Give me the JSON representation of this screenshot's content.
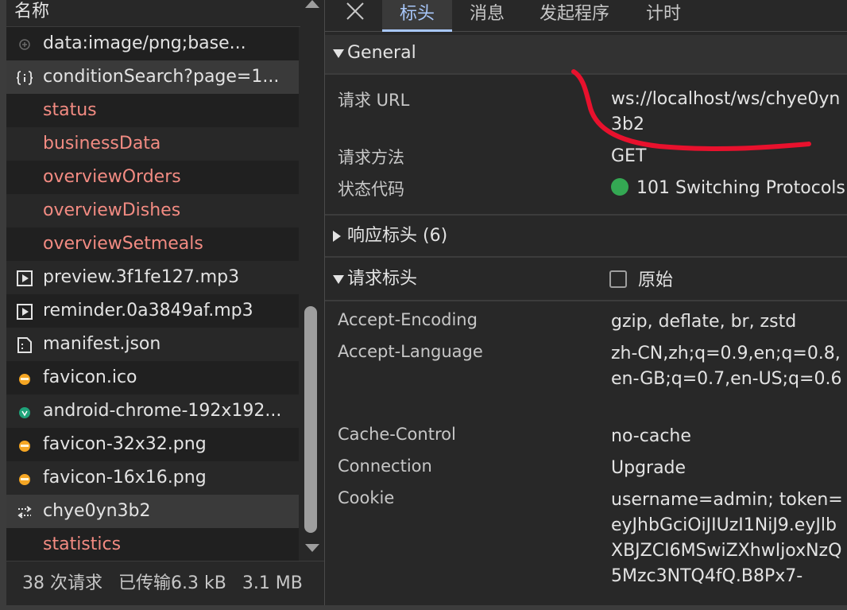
{
  "request_list": {
    "header": "名称",
    "rows": [
      {
        "icon": "image-icon",
        "name": "data:image/png;base...",
        "style": "normal"
      },
      {
        "icon": "fetch-icon",
        "name": "conditionSearch?page=1...",
        "style": "normal"
      },
      {
        "icon": "",
        "name": "status",
        "style": "red"
      },
      {
        "icon": "",
        "name": "businessData",
        "style": "red"
      },
      {
        "icon": "",
        "name": "overviewOrders",
        "style": "red"
      },
      {
        "icon": "",
        "name": "overviewDishes",
        "style": "red"
      },
      {
        "icon": "",
        "name": "overviewSetmeals",
        "style": "red"
      },
      {
        "icon": "media-icon",
        "name": "preview.3f1fe127.mp3",
        "style": "normal"
      },
      {
        "icon": "media-icon",
        "name": "reminder.0a3849af.mp3",
        "style": "normal"
      },
      {
        "icon": "document-icon",
        "name": "manifest.json",
        "style": "normal"
      },
      {
        "icon": "favicon-orange-icon",
        "name": "favicon.ico",
        "style": "normal"
      },
      {
        "icon": "favicon-green-icon",
        "name": "android-chrome-192x192...",
        "style": "normal"
      },
      {
        "icon": "favicon-orange-icon",
        "name": "favicon-32x32.png",
        "style": "normal"
      },
      {
        "icon": "favicon-orange-icon",
        "name": "favicon-16x16.png",
        "style": "normal"
      },
      {
        "icon": "websocket-icon",
        "name": "chye0yn3b2",
        "style": "selected"
      },
      {
        "icon": "",
        "name": "statistics",
        "style": "red"
      }
    ],
    "footer": {
      "requests": "38 次请求",
      "transferred": "已传输6.3 kB",
      "resources": "3.1 MB"
    }
  },
  "detail": {
    "tabs": [
      "标头",
      "消息",
      "发起程序",
      "计时"
    ],
    "active_tab": "标头",
    "general": {
      "title": "General",
      "rows": [
        {
          "label": "请求 URL",
          "value": "ws://localhost/ws/chye0yn3b2"
        },
        {
          "label": "请求方法",
          "value": "GET"
        },
        {
          "label": "状态代码",
          "value": "101 Switching Protocols"
        }
      ]
    },
    "response_headers": {
      "title": "响应标头 (6)"
    },
    "request_headers": {
      "title": "请求标头",
      "raw_label": "原始",
      "rows": [
        {
          "label": "Accept-Encoding",
          "value": "gzip, deflate, br, zstd"
        },
        {
          "label": "Accept-Language",
          "value": "zh-CN,zh;q=0.9,en;q=0.8,en-GB;q=0.7,en-US;q=0.6"
        },
        {
          "label": "Cache-Control",
          "value": "no-cache"
        },
        {
          "label": "Connection",
          "value": "Upgrade"
        },
        {
          "label": "Cookie",
          "value": "username=admin; token=eyJhbGciOiJIUzI1NiJ9.eyJlbXBJZCI6MSwiZXhwIjoxNzQ5Mzc3NTQ4fQ.B8Px7-"
        }
      ]
    }
  },
  "colors": {
    "background": "#282828",
    "accent": "#a8c7fa",
    "error_text": "#f28b82",
    "status_ok": "#34a853",
    "annotation": "#e8112d"
  }
}
